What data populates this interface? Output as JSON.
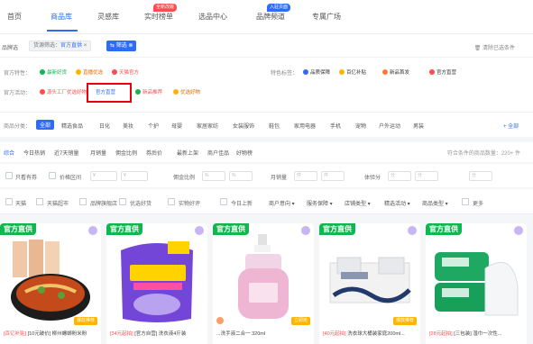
{
  "nav": {
    "tabs": [
      "首页",
      "商品库",
      "灵感库",
      "实时榜单",
      "选品中心",
      "品牌频道",
      "专属广场"
    ],
    "active_tab": "商品库",
    "badges": [
      {
        "text": "全新改版",
        "color": "#ff4d4f"
      },
      {
        "text": "入驻页面",
        "color": "#2f6cf6"
      }
    ]
  },
  "breadcrumb": {
    "label": "品牌选",
    "chip_prefix": "货源筛选：",
    "chip_value": "官方直供",
    "active_chip": "筛选",
    "clear": "清除已选条件"
  },
  "filters": {
    "row1": {
      "label": "官方特性：",
      "options": [
        "最新好货",
        "直播优选",
        "天猫官方"
      ],
      "label2": "特色标签：",
      "options2": [
        "品质保障",
        "百亿补贴",
        "新品首发",
        "官方直营"
      ]
    },
    "row2": {
      "label": "官方活动：",
      "options": [
        "源头工厂优选好物",
        "官方直营",
        "新品推荐",
        "优选好物"
      ],
      "highlighted": "官方直营"
    }
  },
  "categories": {
    "label": "商品分类：",
    "items": [
      "全部",
      "精选食品",
      "日化",
      "美妆",
      "个护",
      "母婴",
      "家居家纺",
      "女装服饰",
      "鞋包",
      "家用电器",
      "手机",
      "宠物",
      "户外运动",
      "男装"
    ],
    "active": "全部",
    "more": "+ 全部"
  },
  "sort": {
    "items": [
      "综合",
      "今日热销",
      "近7天销量",
      "月销量",
      "佣金比例",
      "券后价",
      "最新上架",
      "商户佳品",
      "好物榜"
    ],
    "active": "综合",
    "result": "符合条件的商品数量：220+ 件"
  },
  "inputs": {
    "checkbox_label": "只看有券",
    "price_label": "价格区间",
    "commission_label": "佣金比例",
    "sales_label": "月销量",
    "rating_label": "体验分",
    "placeholder_min": "¥",
    "placeholder_pct": "%",
    "placeholder_num": "件",
    "placeholder_rating": "分"
  },
  "checks": {
    "items": [
      "天猫",
      "天猫超市",
      "品牌旗舰店",
      "优选好货",
      "实物好评",
      "今日上新"
    ],
    "dropdowns": [
      "商户意向",
      "服务保障",
      "店铺类型",
      "精选活动",
      "商品类型"
    ],
    "more_label": "更多"
  },
  "products": [
    {
      "label": "官方直供",
      "tag": "[百亿补贴]",
      "title": "[10元破价] 柳州螺蛳粉米粉",
      "flag": "爆款推荐",
      "color": "#c44a1c"
    },
    {
      "label": "官方直供",
      "tag": "[34元起拍]",
      "title": "[官方自营] 洗衣液4斤装",
      "flag": "",
      "color": "#6b3fc9"
    },
    {
      "label": "官方直供",
      "tag": "",
      "title": "...洗手液二合一 320ml",
      "flag": "立即抢",
      "color": "#f3bfd8"
    },
    {
      "label": "官方直供",
      "tag": "[40元起拍]",
      "title": "洗衣球大桶装家庭200ml...",
      "flag": "爆款推荐",
      "color": "#d9dee6"
    },
    {
      "label": "官方直供",
      "tag": "[28元起拍]",
      "title": "[三包装] 湿巾一次性...",
      "flag": "",
      "color": "#18a05a"
    }
  ]
}
